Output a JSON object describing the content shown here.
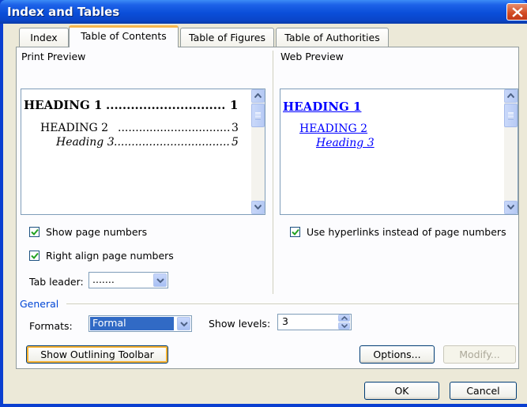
{
  "window": {
    "title": "Index and Tables"
  },
  "tabs": [
    {
      "label": "Index",
      "active": false
    },
    {
      "label": "Table of Contents",
      "active": true
    },
    {
      "label": "Table of Figures",
      "active": false
    },
    {
      "label": "Table of Authorities",
      "active": false
    }
  ],
  "print_preview": {
    "label": "Print Preview",
    "entries": [
      {
        "text": "HEADING 1",
        "page": "1"
      },
      {
        "text": "HEADING 2",
        "page": "3"
      },
      {
        "text": "Heading 3",
        "page": "5"
      }
    ]
  },
  "web_preview": {
    "label": "Web Preview",
    "entries": [
      {
        "text": "HEADING 1"
      },
      {
        "text": "HEADING 2"
      },
      {
        "text": "Heading 3"
      }
    ]
  },
  "options": {
    "show_page_numbers": {
      "label": "Show page numbers",
      "checked": true
    },
    "right_align": {
      "label": "Right align page numbers",
      "checked": true
    },
    "use_hyperlinks": {
      "label": "Use hyperlinks instead of page numbers",
      "checked": true
    },
    "tab_leader": {
      "label": "Tab leader:",
      "value": "......."
    }
  },
  "general": {
    "label": "General",
    "formats": {
      "label": "Formats:",
      "value": "Formal"
    },
    "show_levels": {
      "label": "Show levels:",
      "value": "3"
    }
  },
  "buttons": {
    "show_outlining": "Show Outlining Toolbar",
    "options": "Options...",
    "modify": "Modify...",
    "ok": "OK",
    "cancel": "Cancel"
  },
  "colors": {
    "titlebar": "#0a4ed9",
    "dialog_bg": "#ece9d8",
    "tab_accent": "#f7b64c",
    "selection": "#316ac5",
    "hyperlink": "#0000ff"
  }
}
